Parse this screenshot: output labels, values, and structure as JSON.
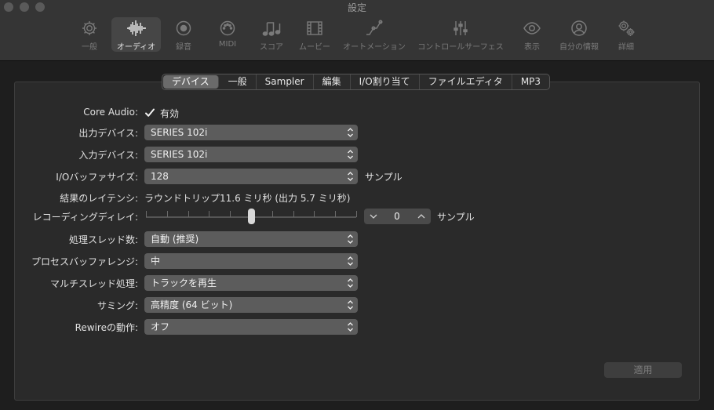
{
  "window": {
    "title": "設定"
  },
  "toolbar": {
    "items": [
      {
        "label": "一般",
        "icon": "gear-icon"
      },
      {
        "label": "オーディオ",
        "icon": "waveform-icon"
      },
      {
        "label": "録音",
        "icon": "record-icon"
      },
      {
        "label": "MIDI",
        "icon": "midi-port-icon"
      },
      {
        "label": "スコア",
        "icon": "music-notes-icon"
      },
      {
        "label": "ムービー",
        "icon": "film-icon"
      },
      {
        "label": "オートメーション",
        "icon": "automation-curve-icon"
      },
      {
        "label": "コントロールサーフェス",
        "icon": "faders-icon"
      },
      {
        "label": "表示",
        "icon": "eye-icon"
      },
      {
        "label": "自分の情報",
        "icon": "person-icon"
      },
      {
        "label": "詳細",
        "icon": "gears-icon"
      }
    ]
  },
  "tabs": [
    "デバイス",
    "一般",
    "Sampler",
    "編集",
    "I/O割り当て",
    "ファイルエディタ",
    "MP3"
  ],
  "form": {
    "core_audio": {
      "label": "Core Audio:",
      "checkbox_label": "有効",
      "checked": true
    },
    "output_device": {
      "label": "出力デバイス:",
      "value": "SERIES 102i"
    },
    "input_device": {
      "label": "入力デバイス:",
      "value": "SERIES 102i"
    },
    "io_buffer": {
      "label": "I/Oバッファサイズ:",
      "value": "128",
      "unit": "サンプル"
    },
    "latency": {
      "label": "結果のレイテンシ:",
      "value": "ラウンドトリップ11.6 ミリ秒 (出力 5.7 ミリ秒)"
    },
    "recording_delay": {
      "label": "レコーディングディレイ:",
      "value": "0",
      "unit": "サンプル",
      "slider_position": 0.5
    },
    "threads": {
      "label": "処理スレッド数:",
      "value": "自動 (推奨)"
    },
    "process_buffer": {
      "label": "プロセスバッファレンジ:",
      "value": "中"
    },
    "multithreading": {
      "label": "マルチスレッド処理:",
      "value": "トラックを再生"
    },
    "summing": {
      "label": "サミング:",
      "value": "高精度 (64 ビット)"
    },
    "rewire": {
      "label": "Rewireの動作:",
      "value": "オフ"
    }
  },
  "apply_button": {
    "label": "適用",
    "enabled": false
  }
}
